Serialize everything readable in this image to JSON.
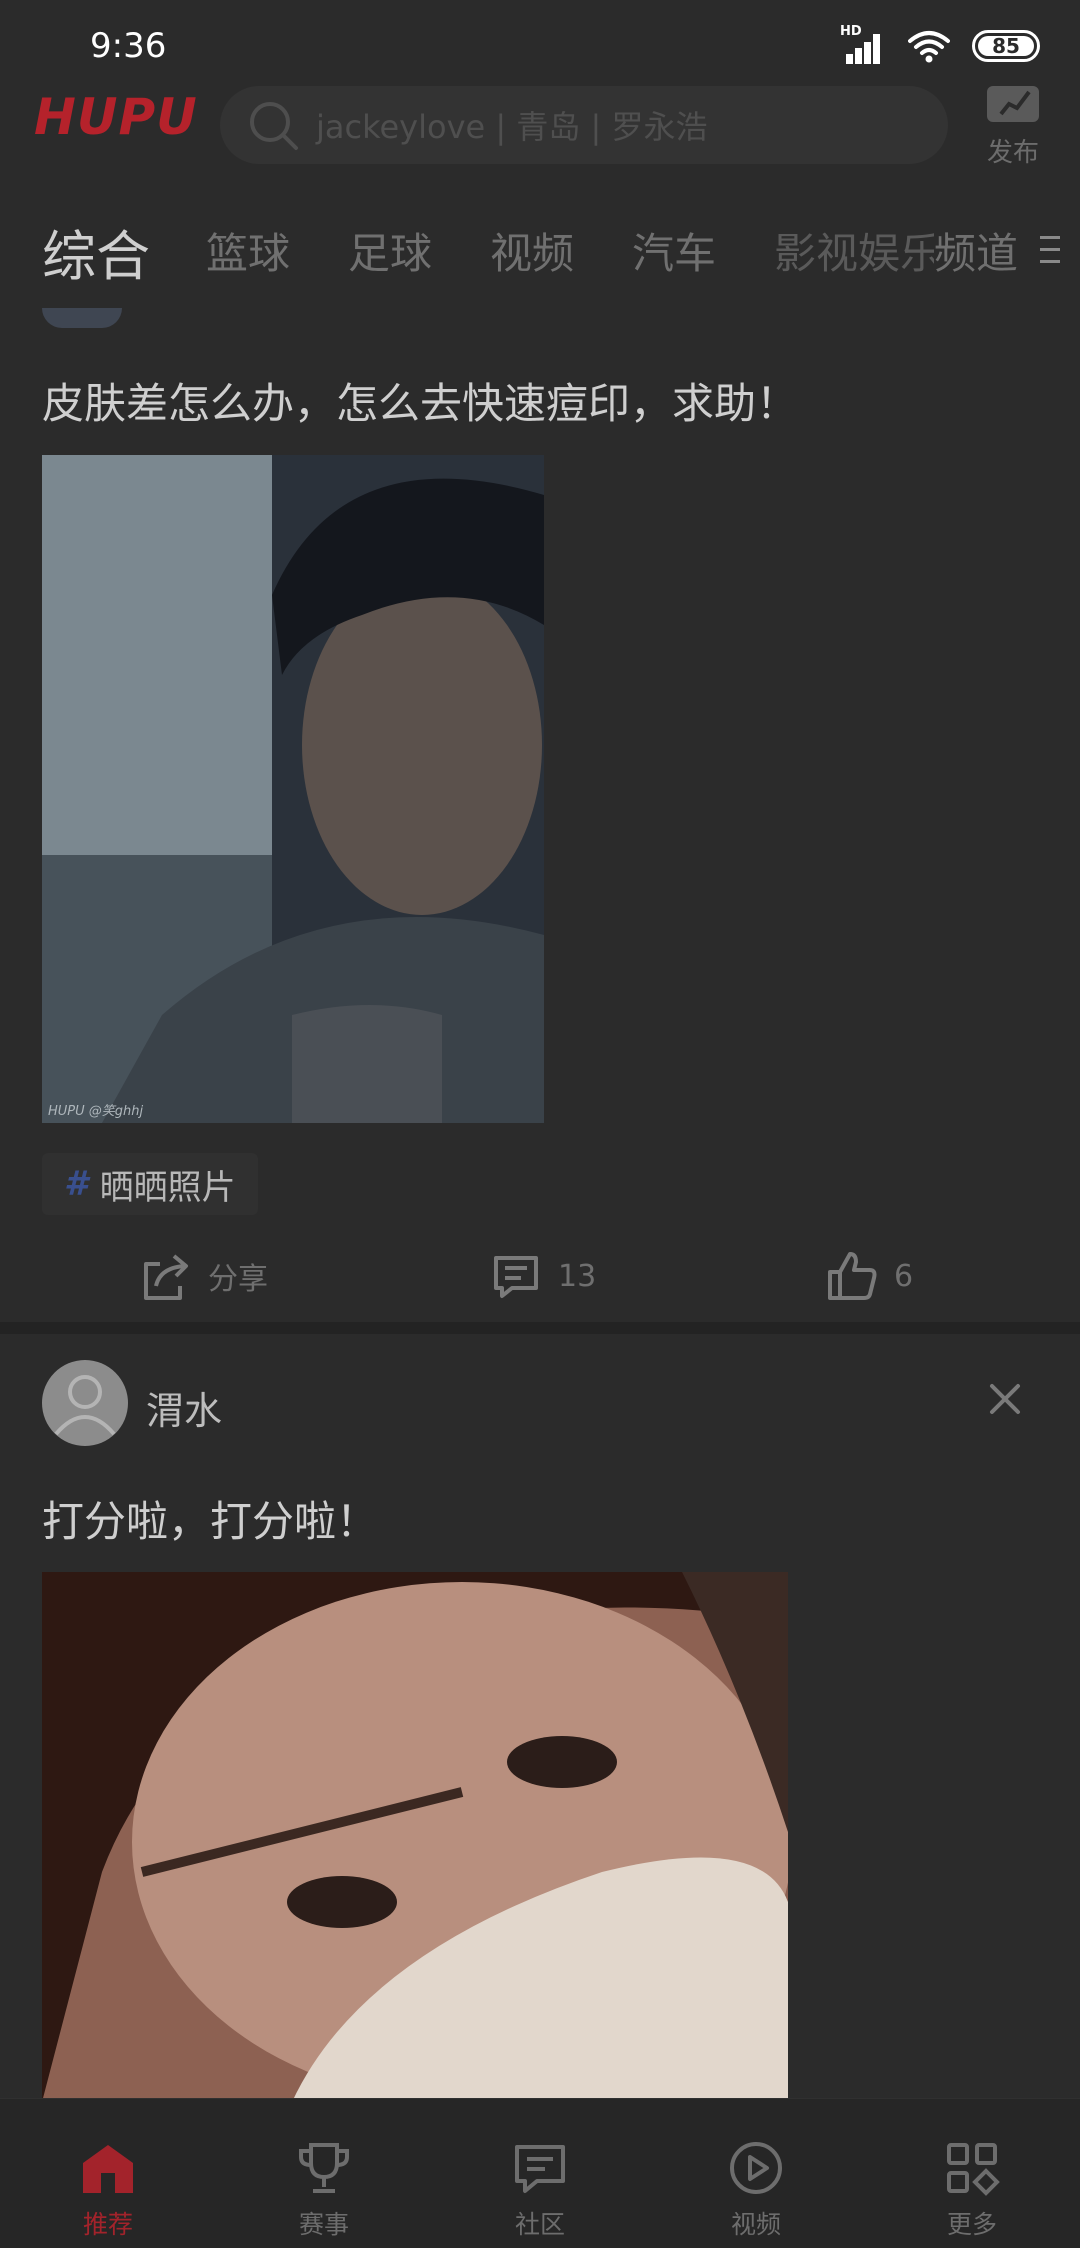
{
  "status_bar": {
    "time": "9:36",
    "network_badge": "HD",
    "battery": "85"
  },
  "header": {
    "logo_text": "HUPU",
    "search_placeholder": "jackeylove | 青岛 | 罗永浩",
    "publish_label": "发布"
  },
  "tabs": [
    {
      "label": "综合",
      "active": true
    },
    {
      "label": "篮球"
    },
    {
      "label": "足球"
    },
    {
      "label": "视频"
    },
    {
      "label": "汽车"
    },
    {
      "label": "影视娱乐"
    },
    {
      "label": "频道"
    }
  ],
  "posts": [
    {
      "title": "皮肤差怎么办，怎么去快速痘印，求助！",
      "image_watermark": "HUPU @笑ghhj",
      "tag": {
        "icon": "hash-icon",
        "label": "晒晒照片"
      },
      "actions": {
        "share_label": "分享",
        "comment_count": "13",
        "like_count": "6"
      }
    },
    {
      "author": "渭水",
      "title": "打分啦，打分啦！"
    }
  ],
  "bottom_nav": [
    {
      "label": "推荐",
      "icon": "home-icon",
      "active": true
    },
    {
      "label": "赛事",
      "icon": "trophy-icon"
    },
    {
      "label": "社区",
      "icon": "community-icon"
    },
    {
      "label": "视频",
      "icon": "video-play-icon"
    },
    {
      "label": "更多",
      "icon": "more-grid-icon"
    }
  ],
  "colors": {
    "background": "#2b2b2b",
    "brand_red": "#b5222b",
    "active_nav": "#a3232b"
  }
}
